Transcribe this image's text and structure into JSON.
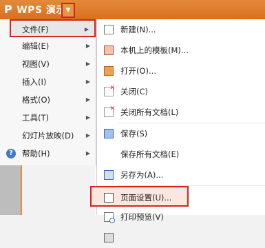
{
  "app": {
    "title": "WPS 演示",
    "logo_glyph": "P",
    "dropdown_glyph": "▼"
  },
  "main_menu": {
    "items": [
      {
        "label": "文件(F)",
        "arrow": "▶"
      },
      {
        "label": "编辑(E)",
        "arrow": "▶"
      },
      {
        "label": "视图(V)",
        "arrow": "▶"
      },
      {
        "label": "插入(I)",
        "arrow": "▶"
      },
      {
        "label": "格式(O)",
        "arrow": "▶"
      },
      {
        "label": "工具(T)",
        "arrow": "▶"
      },
      {
        "label": "幻灯片放映(D)",
        "arrow": "▶"
      },
      {
        "label": "帮助(H)",
        "arrow": "▶"
      }
    ],
    "help_icon": "?"
  },
  "file_menu": {
    "items": [
      {
        "label": "新建(N)...",
        "icon": "new-document-icon"
      },
      {
        "label": "本机上的模板(M)...",
        "icon": "template-icon"
      },
      {
        "label": "打开(O)...",
        "icon": "open-folder-icon"
      },
      {
        "label": "关闭(C)",
        "icon": "close-document-icon"
      },
      {
        "label": "关闭所有文档(L)",
        "icon": "close-all-icon"
      },
      {
        "label": "保存(S)",
        "icon": "save-icon"
      },
      {
        "label": "保存所有文档(E)",
        "icon": ""
      },
      {
        "label": "另存为(A)...",
        "icon": "save-as-icon"
      },
      {
        "label": "页面设置(U)...",
        "icon": "page-setup-icon"
      },
      {
        "label": "打印预览(V)",
        "icon": "print-preview-icon"
      }
    ]
  },
  "colors": {
    "accent": "#d96f1f",
    "highlight_border": "#d4231c"
  }
}
